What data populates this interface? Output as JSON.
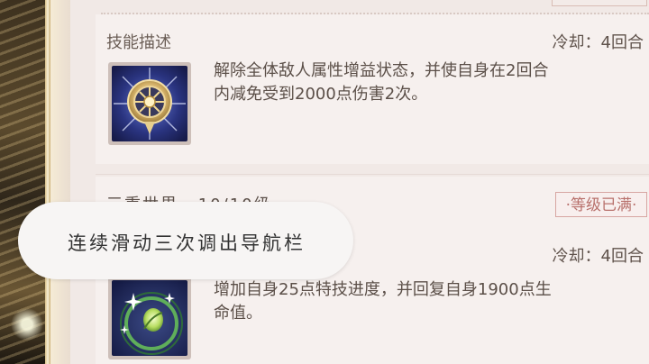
{
  "skill1": {
    "section_title": "技能描述",
    "cooldown": "冷却：4回合",
    "icon": "sun-emblem-icon",
    "description_line1": "解除全体敌人属性增益状态，并使自身在2回合",
    "description_line2": "内减免受到2000点伤害2次。"
  },
  "skill2": {
    "name": "三重世界",
    "level": "10/10级",
    "level_badge": "·等级已满·",
    "cooldown": "冷却：4回合",
    "icon": "sparkle-leaf-icon",
    "description_line1": "增加自身25点特技进度，并回复自身1900点生",
    "description_line2": "命值。"
  },
  "toast": {
    "text": "连续滑动三次调出导航栏"
  },
  "colors": {
    "panel_bg": "#f1e9e6",
    "badge_border": "#d7a6a2",
    "badge_text": "#b8716c"
  }
}
